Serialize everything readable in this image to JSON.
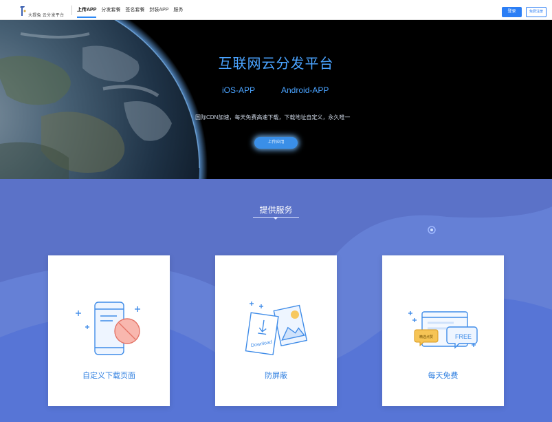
{
  "nav": {
    "logo_text": "大提兔  云分发平台",
    "items": [
      {
        "label": "上传APP",
        "active": true
      },
      {
        "label": "分发套餐",
        "active": false
      },
      {
        "label": "签名套餐",
        "active": false
      },
      {
        "label": "封装APP",
        "active": false
      },
      {
        "label": "服务",
        "active": false
      }
    ],
    "login_label": "登录",
    "register_label": "免费注册"
  },
  "hero": {
    "title": "互联网云分发平台",
    "ios_label": "iOS-APP",
    "android_label": "Android-APP",
    "description": "国际CDN加速，每天免费高速下载，下载地址自定义，永久唯一",
    "button_label": "上传应用"
  },
  "services": {
    "title": "提供服务",
    "cards": [
      {
        "label": "自定义下载页面",
        "icon": "custom-phone-icon"
      },
      {
        "label": "防屏蔽",
        "icon": "anti-block-download-icon"
      },
      {
        "label": "每天免费",
        "icon": "free-chat-icon"
      }
    ],
    "icon_texts": {
      "download": "Download",
      "free": "FREE",
      "badge": "精选点赞"
    }
  },
  "colors": {
    "accent": "#2b7ef5",
    "hero_text": "#4aa3ff",
    "services_bg": "#5b72c8",
    "card_text": "#2f7fe0"
  }
}
